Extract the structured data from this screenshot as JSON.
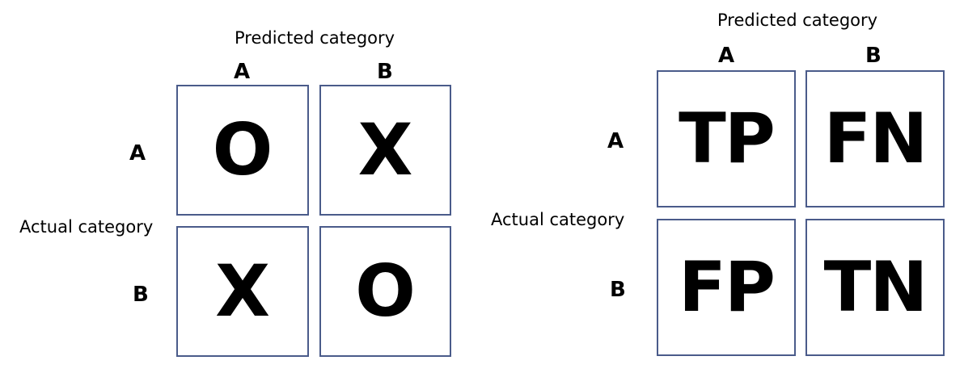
{
  "left_matrix": {
    "predicted_label": "Predicted category",
    "actual_label": "Actual category",
    "col_headers": [
      "A",
      "B"
    ],
    "row_headers": [
      "A",
      "B"
    ],
    "cells": [
      [
        "O",
        "X"
      ],
      [
        "X",
        "O"
      ]
    ]
  },
  "right_matrix": {
    "predicted_label": "Predicted category",
    "actual_label": "Actual category",
    "col_headers": [
      "A",
      "B"
    ],
    "row_headers": [
      "A",
      "B"
    ],
    "cells": [
      [
        "TP",
        "FN"
      ],
      [
        "FP",
        "TN"
      ]
    ]
  },
  "colors": {
    "cell_border": "#4a5b8a"
  }
}
